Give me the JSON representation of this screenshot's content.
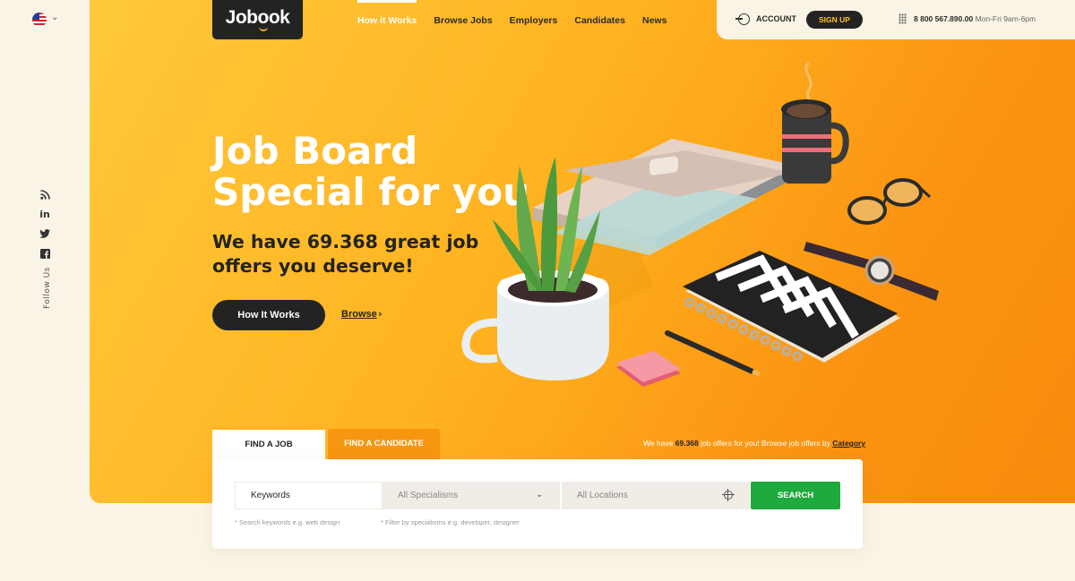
{
  "brand": {
    "logo": "Jobook"
  },
  "nav": [
    "How it Works",
    "Browse Jobs",
    "Employers",
    "Candidates",
    "News"
  ],
  "header": {
    "account": "ACCOUNT",
    "signup": "SIGN UP",
    "phone": "8 800 567.890.00",
    "hours": "Mon-Fri 9am-6pm"
  },
  "sidebar": {
    "language_icon": "us-flag-icon",
    "social": [
      "rss-icon",
      "linkedin-icon",
      "twitter-icon",
      "facebook-icon"
    ],
    "follow": "Follow Us"
  },
  "hero": {
    "title_line1": "Job Board",
    "title_line2": "Special for you",
    "subtitle_line1": "We have 69.368 great job",
    "subtitle_line2": "offers you deserve!",
    "cta": "How It Works",
    "browse": "Browse"
  },
  "search": {
    "tabs": [
      "FIND A JOB",
      "FIND A CANDIDATE"
    ],
    "offers_prefix": "We have",
    "offers_count": "69.368",
    "offers_mid": "job offers for you! Browse job offers by",
    "offers_link": "Category",
    "keywords_placeholder": "Keywords",
    "specialisms": "All Specialisms",
    "locations": "All Locations",
    "button": "SEARCH",
    "hint_keywords": "* Search keywords e.g. web design",
    "hint_specialisms": "* Filter by specialisms e.g. developer, designer"
  },
  "colors": {
    "accent": "#ffb21f",
    "dark": "#232323",
    "search": "#1eaa3c",
    "tab_inactive": "#f7960f"
  }
}
